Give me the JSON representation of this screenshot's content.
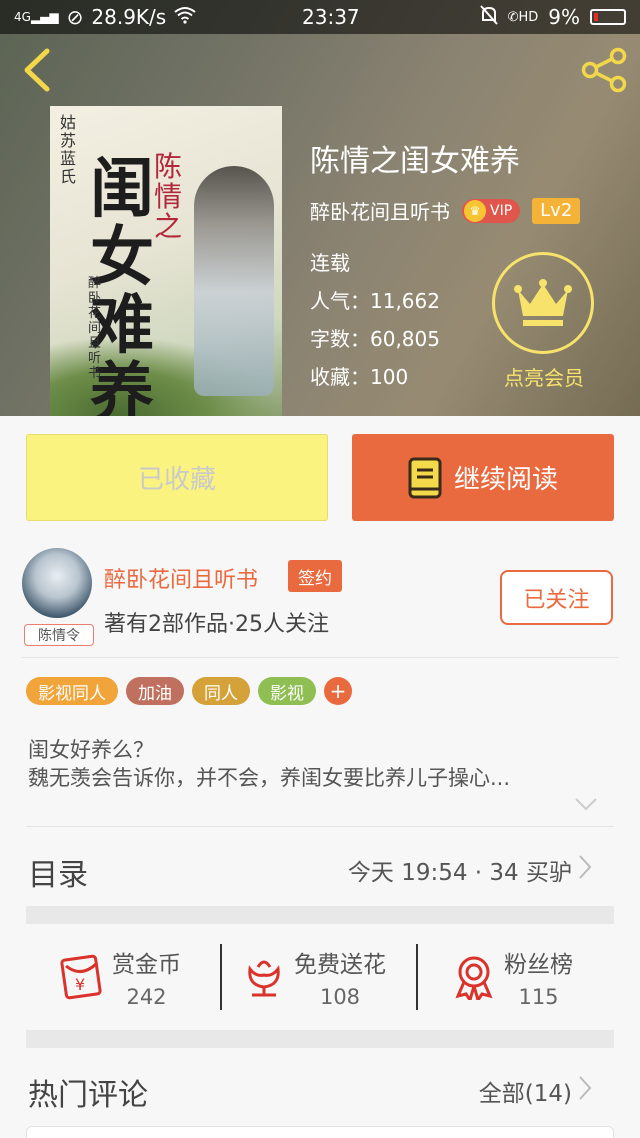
{
  "status_bar": {
    "network": "4G",
    "speed": "28.9K/s",
    "time": "23:37",
    "battery": "9%",
    "hd_label": "HD"
  },
  "book": {
    "title": "陈情之闺女难养",
    "author": "醉卧花间且听书",
    "vip_label": "VIP",
    "level": "Lv2",
    "status": "连载",
    "popularity": "人气：11,662",
    "word_count": "字数：60,805",
    "favorites": "收藏：100"
  },
  "cover": {
    "title_main": "闺女难养",
    "title_prefix": "陈情之",
    "author_vertical": "醉卧花间且听书",
    "publisher": "姑苏蓝氏"
  },
  "member": {
    "label": "点亮会员"
  },
  "actions": {
    "collected_label": "已收藏",
    "continue_label": "继续阅读"
  },
  "author_section": {
    "avatar_tag": "陈情令",
    "name": "醉卧花间且听书",
    "signed_label": "签约",
    "stats": "著有2部作品·25人关注",
    "follow_label": "已关注"
  },
  "tags": [
    {
      "label": "影视同人",
      "color": "#f1a43a"
    },
    {
      "label": "加油",
      "color": "#c0705e"
    },
    {
      "label": "同人",
      "color": "#d4a238"
    },
    {
      "label": "影视",
      "color": "#8fbf52"
    }
  ],
  "tag_add": "+",
  "description": {
    "line1": "闺女好养么？",
    "line2": "魏无羡会告诉你，并不会，养闺女要比养儿子操心..."
  },
  "toc": {
    "title": "目录",
    "update": "今天 19:54 · 34 买驴"
  },
  "stats": [
    {
      "label": "赏金币",
      "value": "242"
    },
    {
      "label": "免费送花",
      "value": "108"
    },
    {
      "label": "粉丝榜",
      "value": "115"
    }
  ],
  "comments": {
    "title": "热门评论",
    "all_label": "全部(14)"
  },
  "colors": {
    "accent": "#ea6a3f",
    "collected_bg": "#fbf380",
    "member_gold": "#f7e36b"
  }
}
